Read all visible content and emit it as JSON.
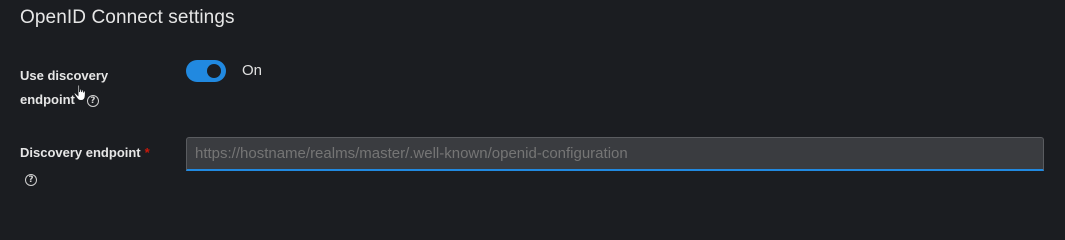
{
  "section": {
    "title": "OpenID Connect settings"
  },
  "discovery": {
    "label_line1": "Use discovery",
    "label_line2": "endpoint",
    "help_icon": "question-circle-icon",
    "toggle_state": "on",
    "toggle_label": "On",
    "accent_color": "#2189e0"
  },
  "endpoint": {
    "label": "Discovery endpoint",
    "required_marker": "*",
    "help_icon": "question-circle-icon",
    "placeholder": "https://hostname/realms/master/.well-known/openid-configuration",
    "value": ""
  }
}
